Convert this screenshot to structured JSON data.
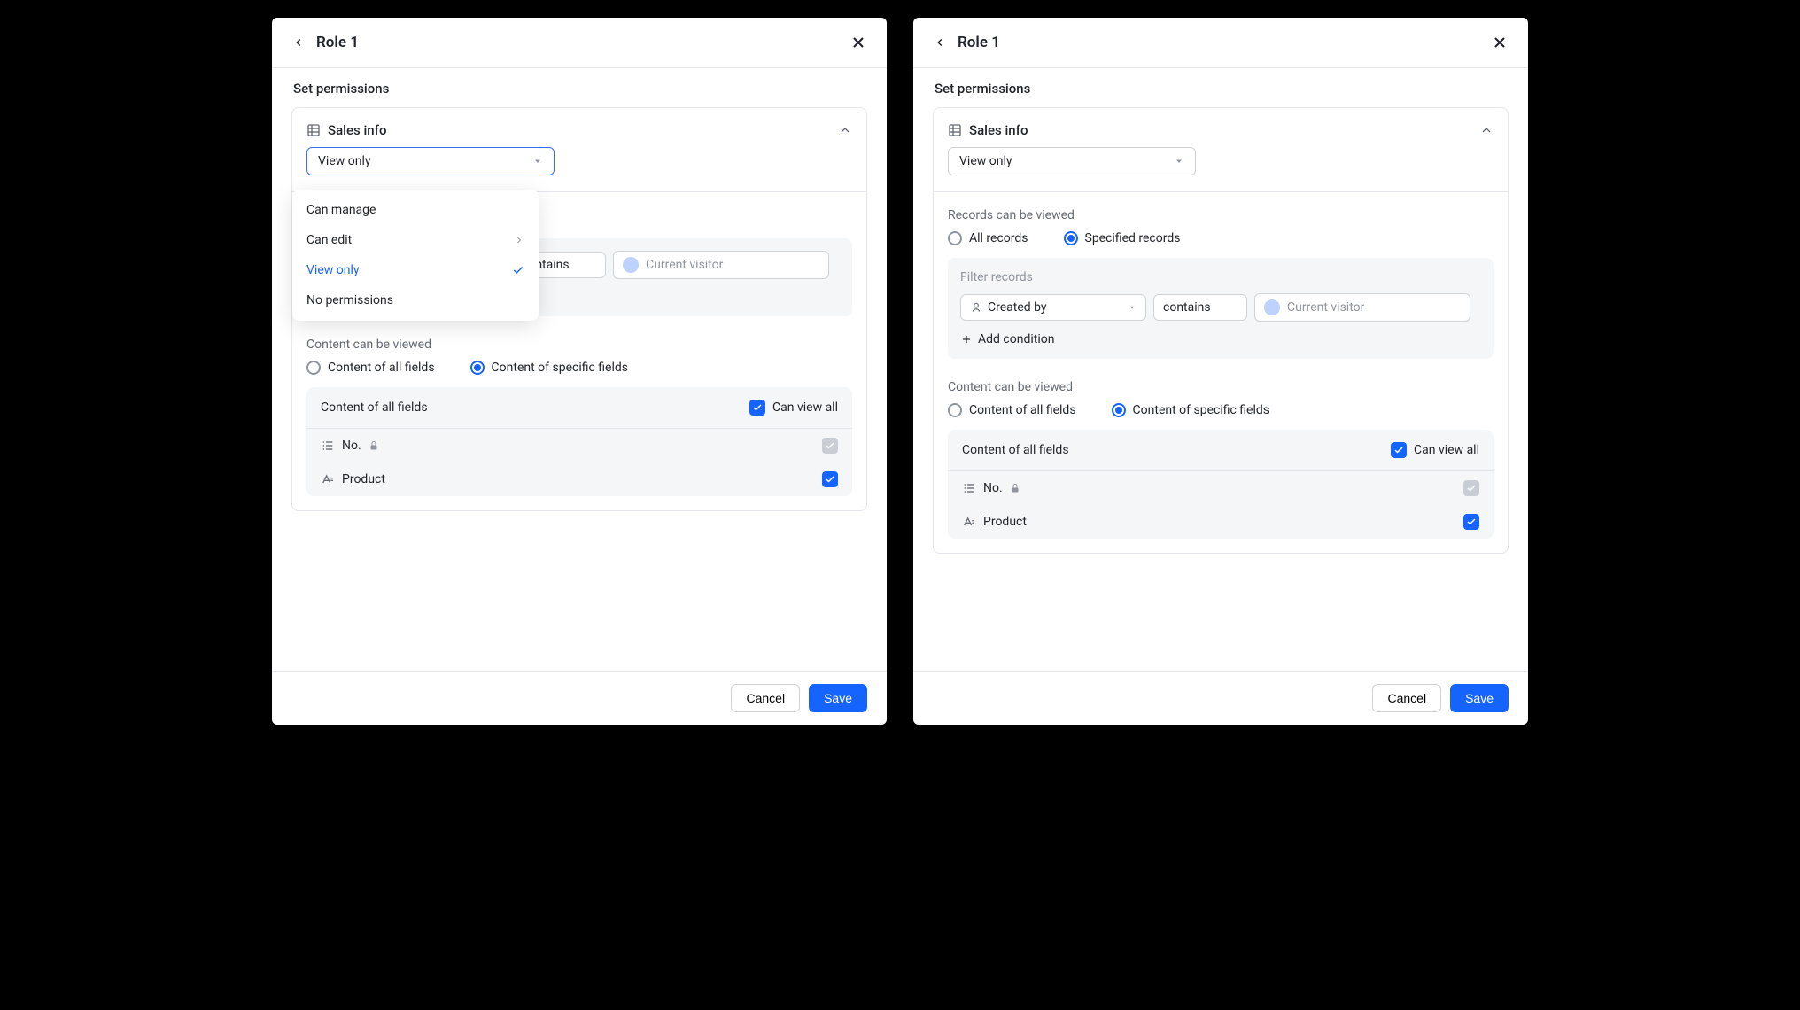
{
  "header": {
    "title": "Role 1",
    "subtitle": "Set permissions"
  },
  "card": {
    "title": "Sales info",
    "permission_select": "View only"
  },
  "dropdown": {
    "options": [
      {
        "label": "Can manage",
        "selected": false,
        "submenu": false
      },
      {
        "label": "Can edit",
        "selected": false,
        "submenu": true
      },
      {
        "label": "View only",
        "selected": true,
        "submenu": false
      },
      {
        "label": "No permissions",
        "selected": false,
        "submenu": false
      }
    ]
  },
  "records": {
    "label": "Records can be viewed",
    "opt_all": "All records",
    "opt_specified": "Specified records",
    "filter_label": "Filter records",
    "field": "Created by",
    "condition": "contains",
    "value": "Current visitor",
    "add_condition": "Add condition"
  },
  "content": {
    "label": "Content can be viewed",
    "opt_all": "Content of all fields",
    "opt_specific": "Content of specific fields",
    "header_label": "Content of all fields",
    "header_check": "Can view all",
    "fields": [
      {
        "name": "No.",
        "locked": true,
        "icon": "number",
        "checked": true,
        "disabled": true
      },
      {
        "name": "Product",
        "locked": false,
        "icon": "text",
        "checked": true,
        "disabled": false
      }
    ]
  },
  "footer": {
    "cancel": "Cancel",
    "save": "Save"
  }
}
